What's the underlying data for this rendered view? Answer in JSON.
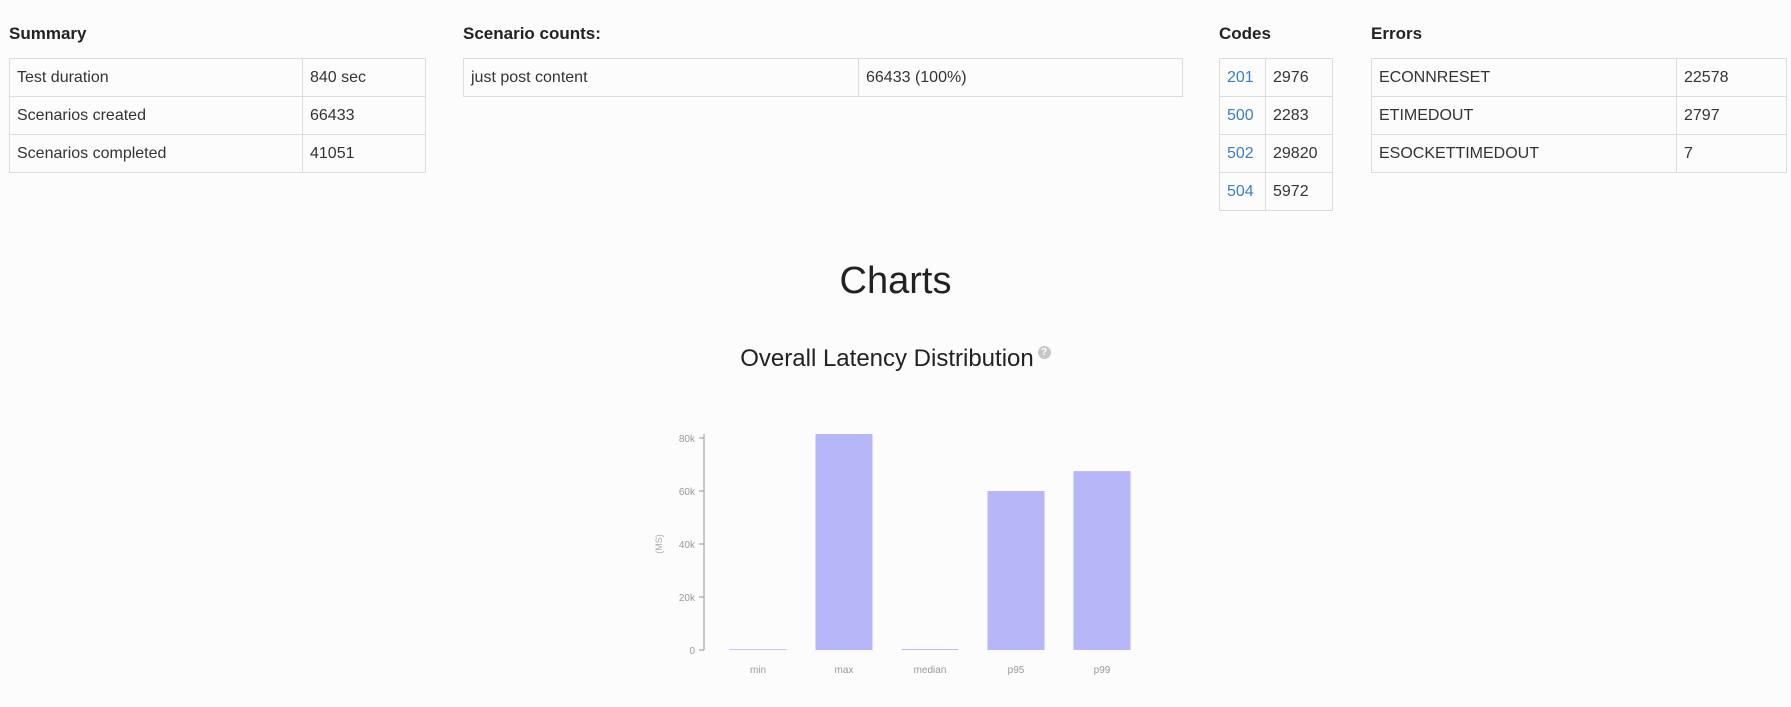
{
  "summary": {
    "title": "Summary",
    "rows": [
      {
        "label": "Test duration",
        "value": "840 sec"
      },
      {
        "label": "Scenarios created",
        "value": "66433"
      },
      {
        "label": "Scenarios completed",
        "value": "41051"
      }
    ]
  },
  "scenario_counts": {
    "title": "Scenario counts:",
    "rows": [
      {
        "label": "just post content",
        "value": "66433 (100%)"
      }
    ]
  },
  "codes": {
    "title": "Codes",
    "rows": [
      {
        "code": "201",
        "count": "2976"
      },
      {
        "code": "500",
        "count": "2283"
      },
      {
        "code": "502",
        "count": "29820"
      },
      {
        "code": "504",
        "count": "5972"
      }
    ]
  },
  "errors": {
    "title": "Errors",
    "rows": [
      {
        "label": "ECONNRESET",
        "value": "22578"
      },
      {
        "label": "ETIMEDOUT",
        "value": "2797"
      },
      {
        "label": "ESOCKETTIMEDOUT",
        "value": "7"
      }
    ]
  },
  "charts": {
    "heading": "Charts",
    "latency_title": "Overall Latency Distribution",
    "help_icon": "question-circle-icon"
  },
  "colors": {
    "bar": "#b6b6f8",
    "code_link": "#3c7fbf"
  },
  "chart_data": {
    "type": "bar",
    "categories": [
      "min",
      "max",
      "median",
      "p95",
      "p99"
    ],
    "values": [
      300,
      81500,
      350,
      60000,
      67500
    ],
    "ylabel": "(MS)",
    "ylim": [
      0,
      80000
    ],
    "yticks": [
      0,
      20000,
      40000,
      60000,
      80000
    ],
    "ytick_labels": [
      "0",
      "20k",
      "40k",
      "60k",
      "80k"
    ],
    "grid": false
  }
}
